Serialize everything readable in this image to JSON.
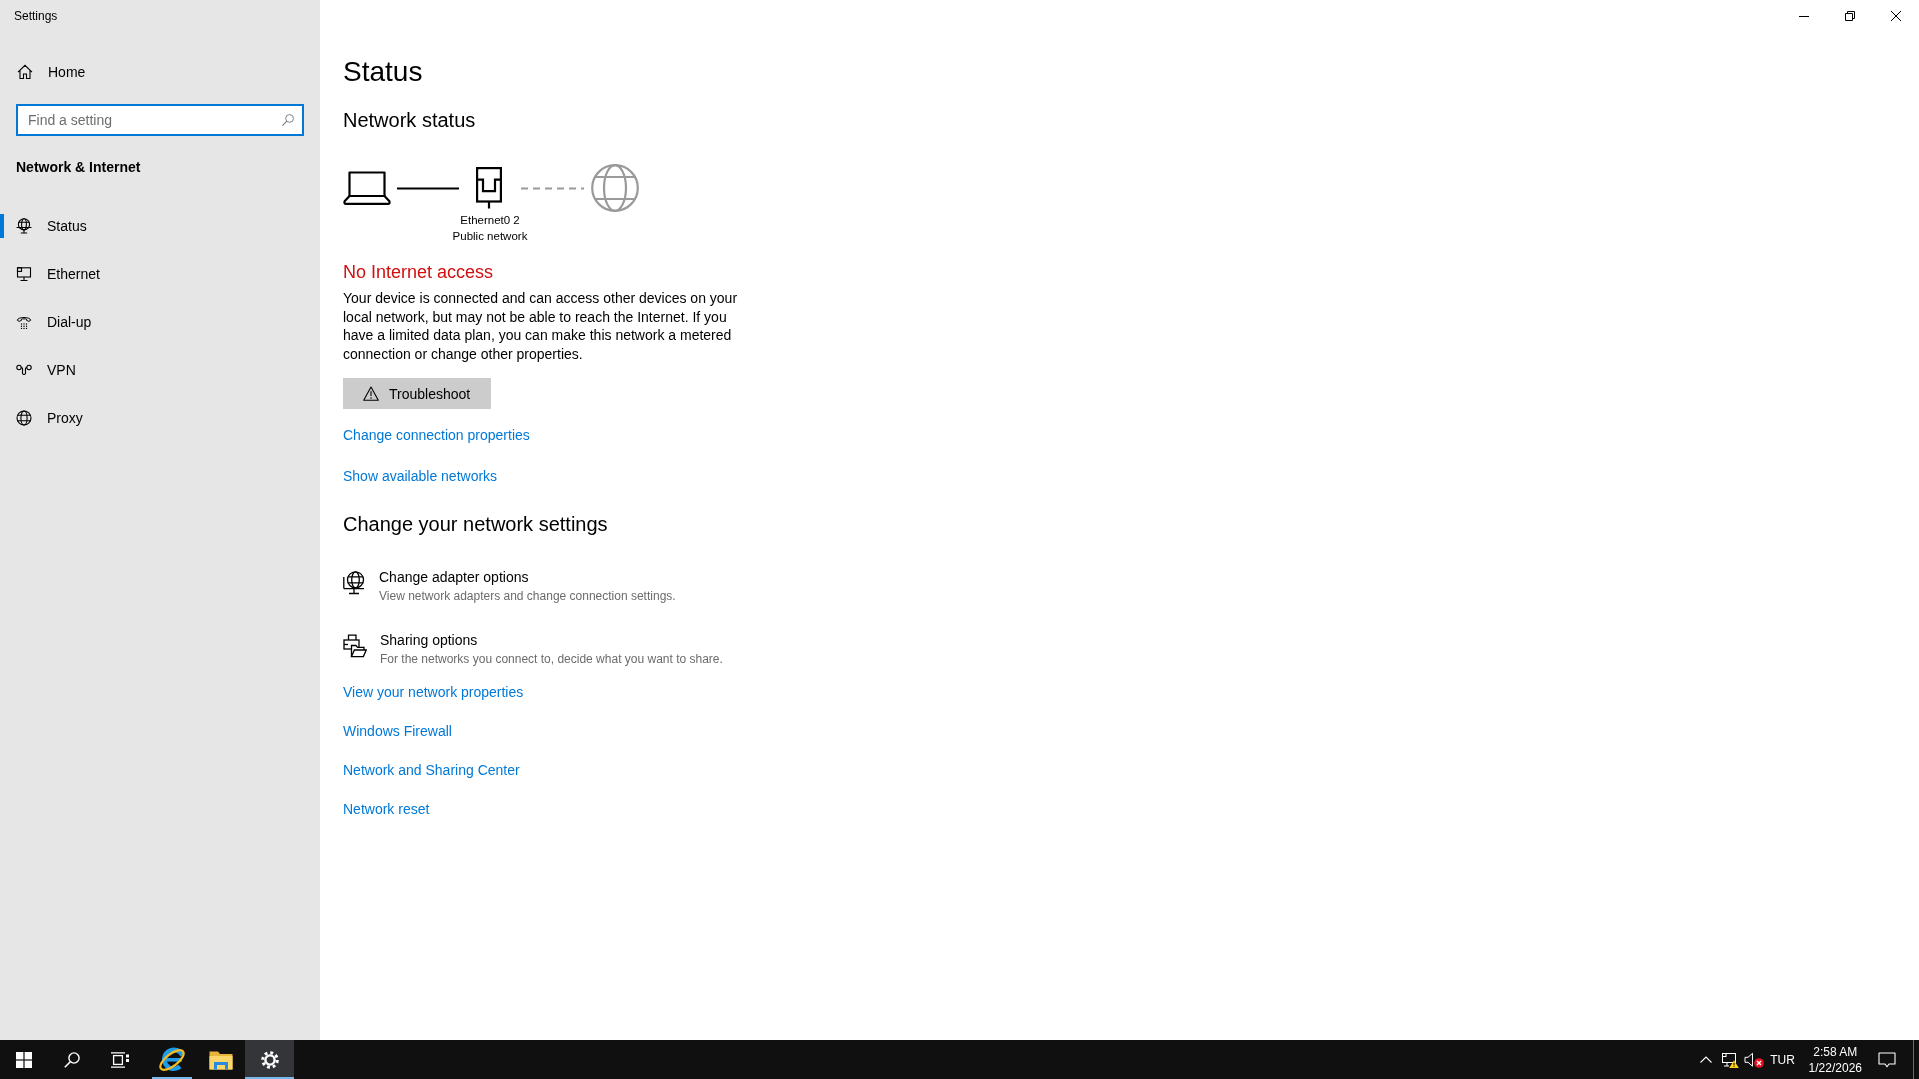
{
  "window": {
    "title": "Settings"
  },
  "sidebar": {
    "home": "Home",
    "search": {
      "placeholder": "Find a setting"
    },
    "section_title": "Network & Internet",
    "items": [
      {
        "label": "Status",
        "selected": true
      },
      {
        "label": "Ethernet",
        "selected": false
      },
      {
        "label": "Dial-up",
        "selected": false
      },
      {
        "label": "VPN",
        "selected": false
      },
      {
        "label": "Proxy",
        "selected": false
      }
    ]
  },
  "main": {
    "title": "Status",
    "network_status": {
      "heading": "Network status",
      "adapter": "Ethernet0 2",
      "network_profile": "Public network",
      "internet_connected": false,
      "alert": "No Internet access",
      "description": "Your device is connected and can access other devices on your local network, but may not be able to reach the Internet. If you have a limited data plan, you can make this network a metered connection or change other properties.",
      "troubleshoot_button": "Troubleshoot",
      "links": [
        "Change connection properties",
        "Show available networks"
      ]
    },
    "network_settings": {
      "heading": "Change your network settings",
      "options": [
        {
          "title": "Change adapter options",
          "description": "View network adapters and change connection settings."
        },
        {
          "title": "Sharing options",
          "description": "For the networks you connect to, decide what you want to share."
        }
      ],
      "links": [
        "View your network properties",
        "Windows Firewall",
        "Network and Sharing Center",
        "Network reset"
      ]
    }
  },
  "taskbar": {
    "apps": [
      {
        "running": true,
        "selected": false
      },
      {
        "running": false,
        "selected": false
      },
      {
        "running": true,
        "selected": true
      }
    ],
    "tray": {
      "language": "TUR",
      "time": "2:58 AM",
      "date": "1/22/2026"
    }
  }
}
